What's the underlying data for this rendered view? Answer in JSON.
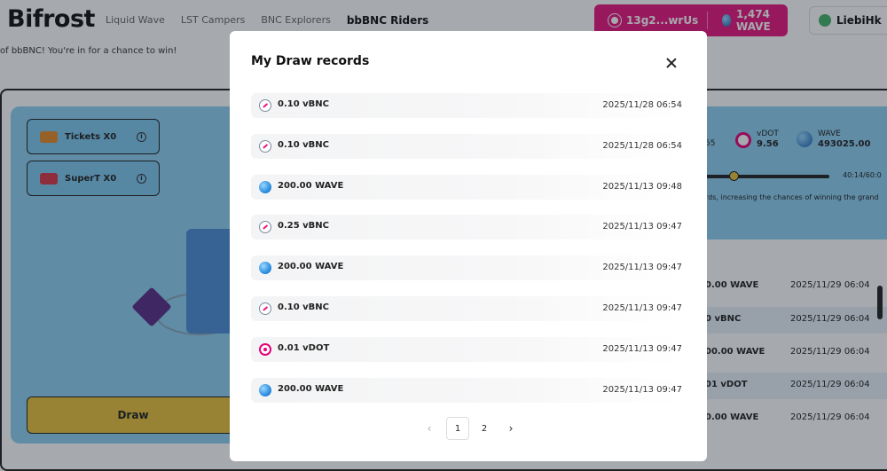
{
  "header": {
    "logo": "Bifrost",
    "nav": [
      "Liquid Wave",
      "LST Campers",
      "BNC Explorers",
      "bbBNC Riders"
    ],
    "active_nav": "bbBNC Riders",
    "wallet_address": "13g2...wrUs",
    "wallet_balance": "1,474 WAVE",
    "username": "LiebiHk"
  },
  "background": {
    "subline": "of bbBNC! You're in for a chance to win!",
    "tickets_label": "Tickets X0",
    "supert_label": "SuperT X0",
    "draw_label": "Draw",
    "stat_partial": "55",
    "vdot_label": "vDOT",
    "vdot_value": "9.56",
    "wave_label": "WAVE",
    "wave_value": "493025.00",
    "slider_label": "40:14/60:0",
    "hint": "rds, increasing the chances of winning the grand",
    "rows": [
      {
        "amount": "0.00 WAVE",
        "time": "2025/11/29 06:04"
      },
      {
        "amount": "0 vBNC",
        "time": "2025/11/29 06:04"
      },
      {
        "amount": "00.00 WAVE",
        "time": "2025/11/29 06:04"
      },
      {
        "amount": "01 vDOT",
        "time": "2025/11/29 06:04"
      },
      {
        "amount": "0.00 WAVE",
        "time": "2025/11/29 06:04"
      }
    ]
  },
  "modal": {
    "title": "My Draw records",
    "records": [
      {
        "icon": "vbnc-icon",
        "amount": "0.10 vBNC",
        "time": "2025/11/28 06:54"
      },
      {
        "icon": "vbnc-icon",
        "amount": "0.10 vBNC",
        "time": "2025/11/28 06:54"
      },
      {
        "icon": "wave-icon",
        "amount": "200.00 WAVE",
        "time": "2025/11/13 09:48"
      },
      {
        "icon": "vbnc-icon",
        "amount": "0.25 vBNC",
        "time": "2025/11/13 09:47"
      },
      {
        "icon": "wave-icon",
        "amount": "200.00 WAVE",
        "time": "2025/11/13 09:47"
      },
      {
        "icon": "vbnc-icon",
        "amount": "0.10 vBNC",
        "time": "2025/11/13 09:47"
      },
      {
        "icon": "vdot-icon",
        "amount": "0.01 vDOT",
        "time": "2025/11/13 09:47"
      },
      {
        "icon": "wave-icon",
        "amount": "200.00 WAVE",
        "time": "2025/11/13 09:47"
      }
    ],
    "pagination": {
      "prev": "‹",
      "pages": [
        "1",
        "2"
      ],
      "current": "1",
      "next": "›"
    }
  },
  "colors": {
    "accent_pink": "#e8157f",
    "sky_blue": "#8fd1f2",
    "draw_yellow": "#e7c23b"
  }
}
